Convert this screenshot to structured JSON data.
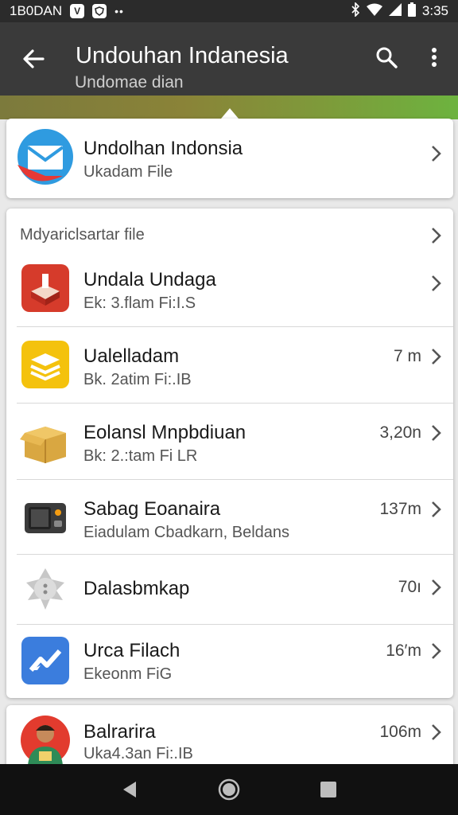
{
  "status_bar": {
    "left_text": "1B0DAN",
    "right_text": "3:35",
    "icons": [
      "app-v-icon",
      "app-shield-icon",
      "more-dots-icon",
      "bluetooth-icon",
      "wifi-icon",
      "signal-icon",
      "battery-icon"
    ]
  },
  "toolbar": {
    "title": "Undouhan Indanesia",
    "subtitle": "Undomae dian",
    "back_icon": "arrow-back-icon",
    "search_icon": "search-icon",
    "more_icon": "more-vert-icon"
  },
  "top_card": {
    "name": "Undolhan Indonsia",
    "meta": "Ukadam File",
    "icon": "mail-icon"
  },
  "list_card": {
    "header": "Mdyariclsartar file",
    "items": [
      {
        "name": "Undala Undaga",
        "meta": "Ek: 3.flam Fi:I.S",
        "size": "",
        "icon": "red-box-icon"
      },
      {
        "name": "Ualelladam",
        "meta": "Bk. 2atim Fi:.IB",
        "size": "7 m",
        "icon": "yellow-stack-icon"
      },
      {
        "name": "Eolansl Mnpbdiuan",
        "meta": "Bk: 2.:tam Fi LR",
        "size": "3,20n",
        "icon": "cardboard-box-icon"
      },
      {
        "name": "Sabag Eoanaira",
        "meta": "Eiadulam Cbadkarn, Beldans",
        "size": "137m",
        "icon": "device-icon"
      },
      {
        "name": "Dalasbmkap",
        "meta": "",
        "size": "70ı",
        "icon": "gray-gear-icon"
      },
      {
        "name": "Urca Filach",
        "meta": "Ekeonm FiG",
        "size": "16′m",
        "icon": "blue-chart-icon"
      }
    ]
  },
  "bottom_card": {
    "name": "Balrarira",
    "meta": "Uka4.3an Fi:.IB",
    "size": "106m",
    "icon": "person-avatar-icon"
  },
  "nav_bar": {
    "back": "nav-back-icon",
    "home": "nav-home-icon",
    "recents": "nav-recents-icon"
  },
  "colors": {
    "toolbar": "#3a3a3a",
    "status_bar": "#2b2b2b",
    "band_accent": "#6db33f",
    "card": "#ffffff"
  }
}
